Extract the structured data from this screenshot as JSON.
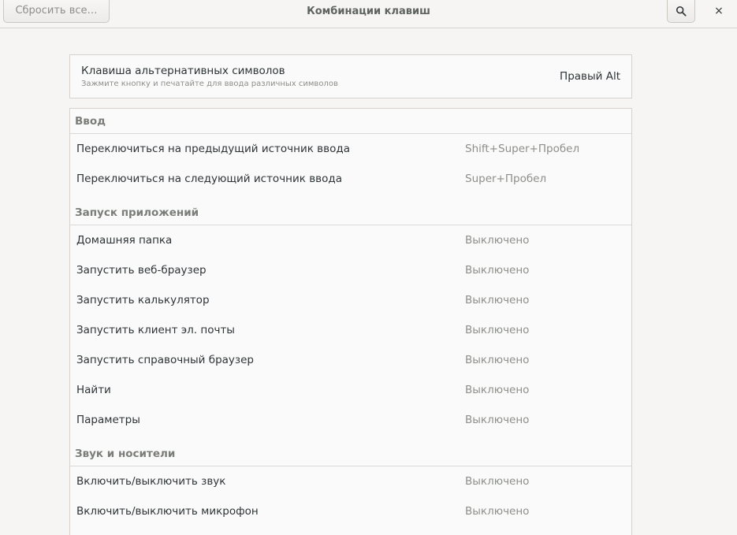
{
  "header": {
    "reset_label": "Сбросить все…",
    "title": "Комбинации клавиш",
    "search_icon": "search-icon",
    "close_label": "×"
  },
  "alt_key": {
    "title": "Клавиша альтернативных символов",
    "subtitle": "Зажмите кнопку и печатайте для ввода различных символов",
    "value": "Правый Alt"
  },
  "sections": [
    {
      "title": "Ввод",
      "items": [
        {
          "label": "Переключиться на предыдущий источник ввода",
          "accel": "Shift+Super+Пробел"
        },
        {
          "label": "Переключиться на следующий источник ввода",
          "accel": "Super+Пробел"
        }
      ]
    },
    {
      "title": "Запуск приложений",
      "items": [
        {
          "label": "Домашняя папка",
          "accel": "Выключено"
        },
        {
          "label": "Запустить веб-браузер",
          "accel": "Выключено"
        },
        {
          "label": "Запустить калькулятор",
          "accel": "Выключено"
        },
        {
          "label": "Запустить клиент эл. почты",
          "accel": "Выключено"
        },
        {
          "label": "Запустить справочный браузер",
          "accel": "Выключено"
        },
        {
          "label": "Найти",
          "accel": "Выключено"
        },
        {
          "label": "Параметры",
          "accel": "Выключено"
        }
      ]
    },
    {
      "title": "Звук и носители",
      "items": [
        {
          "label": "Включить/выключить звук",
          "accel": "Выключено"
        },
        {
          "label": "Включить/выключить микрофон",
          "accel": "Выключено"
        }
      ]
    }
  ]
}
